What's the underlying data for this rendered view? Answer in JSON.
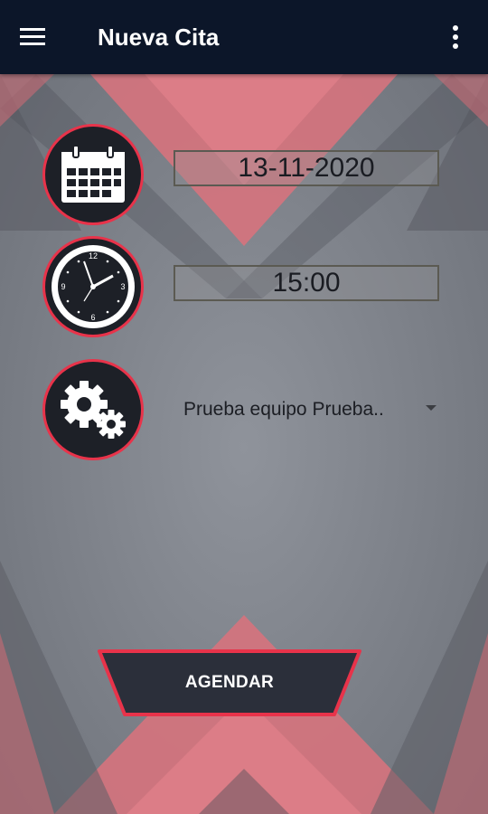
{
  "appbar": {
    "title": "Nueva Cita",
    "menu_icon": "hamburger-menu-icon",
    "overflow_icon": "more-vertical-icon",
    "background_color": "#0c1629"
  },
  "form": {
    "date_icon": "calendar-icon",
    "date_value": "13-11-2020",
    "time_icon": "clock-icon",
    "time_value": "15:00",
    "service_icon": "gears-icon",
    "service_value": "Prueba equipo Prueba..",
    "dropdown_icon": "dropdown-arrow-icon"
  },
  "actions": {
    "submit_label": "AGENDAR"
  },
  "colors": {
    "accent": "#e8334a",
    "dark": "#1d2027",
    "background": "#8a8d94"
  }
}
